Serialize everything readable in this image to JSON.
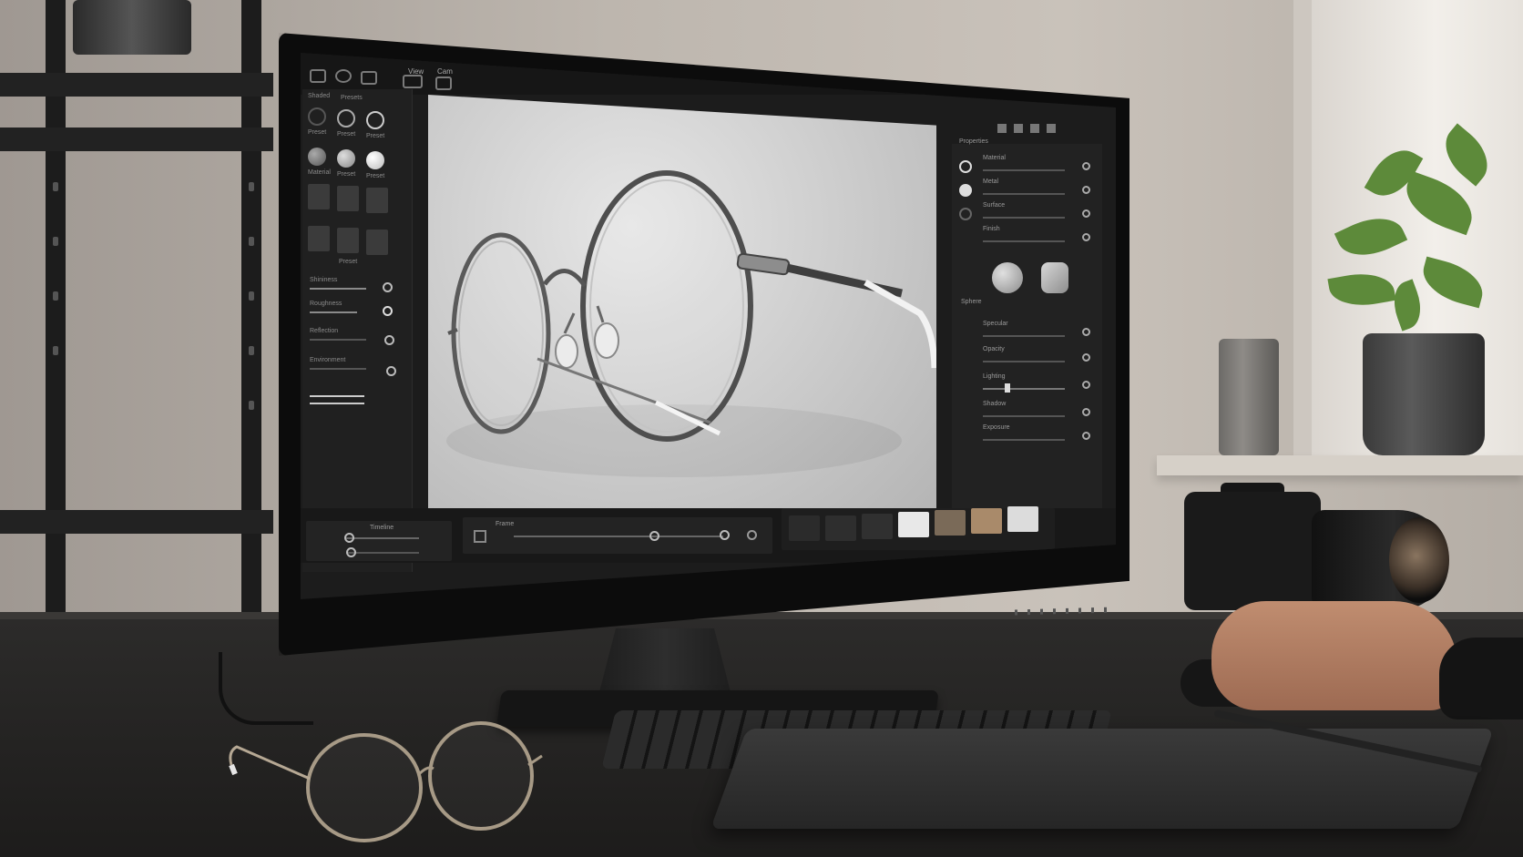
{
  "scene": {
    "description_tags": [
      "desk",
      "monitor",
      "eyeglasses",
      "camera",
      "plant",
      "keyboard",
      "drawing-tablet"
    ]
  },
  "app": {
    "toolbar": {
      "icons": [
        "cube-icon",
        "sphere-icon",
        "cylinder-icon",
        "folder-icon",
        "image-icon"
      ]
    },
    "left_panel": {
      "header_labels": [
        "Shaded",
        "Presets"
      ],
      "ring_labels": [
        "Preset",
        "Preset",
        "Preset"
      ],
      "ball_labels": [
        "Material",
        "Preset",
        "Preset"
      ],
      "tile_label": "Preset",
      "slider_labels": [
        "Shininess",
        "Roughness",
        "Reflection",
        "Environment"
      ]
    },
    "viewport": {
      "tabs": [
        "View",
        "Cam"
      ]
    },
    "right_panel": {
      "title": "Properties",
      "rows": [
        "Material",
        "Metal",
        "Surface",
        "Finish",
        "Specular",
        "Opacity",
        "Lighting",
        "Shadow",
        "Exposure"
      ],
      "material_preview_label": "Sphere"
    },
    "bottom_bar": {
      "left_label": "Timeline",
      "playback_label": "Frame",
      "swatch_colors": [
        "#2b2b2b",
        "#2e2e2e",
        "#303030",
        "#e8e8e8",
        "#7a6a58",
        "#a98a6a",
        "#dcdcdc"
      ]
    }
  },
  "colors": {
    "ui_background": "#1c1c1c",
    "panel": "#202020",
    "viewport_light": "#e6e6e6",
    "frame_metal": "#6a6a6a",
    "temple_tip": "#f2f2f2"
  }
}
